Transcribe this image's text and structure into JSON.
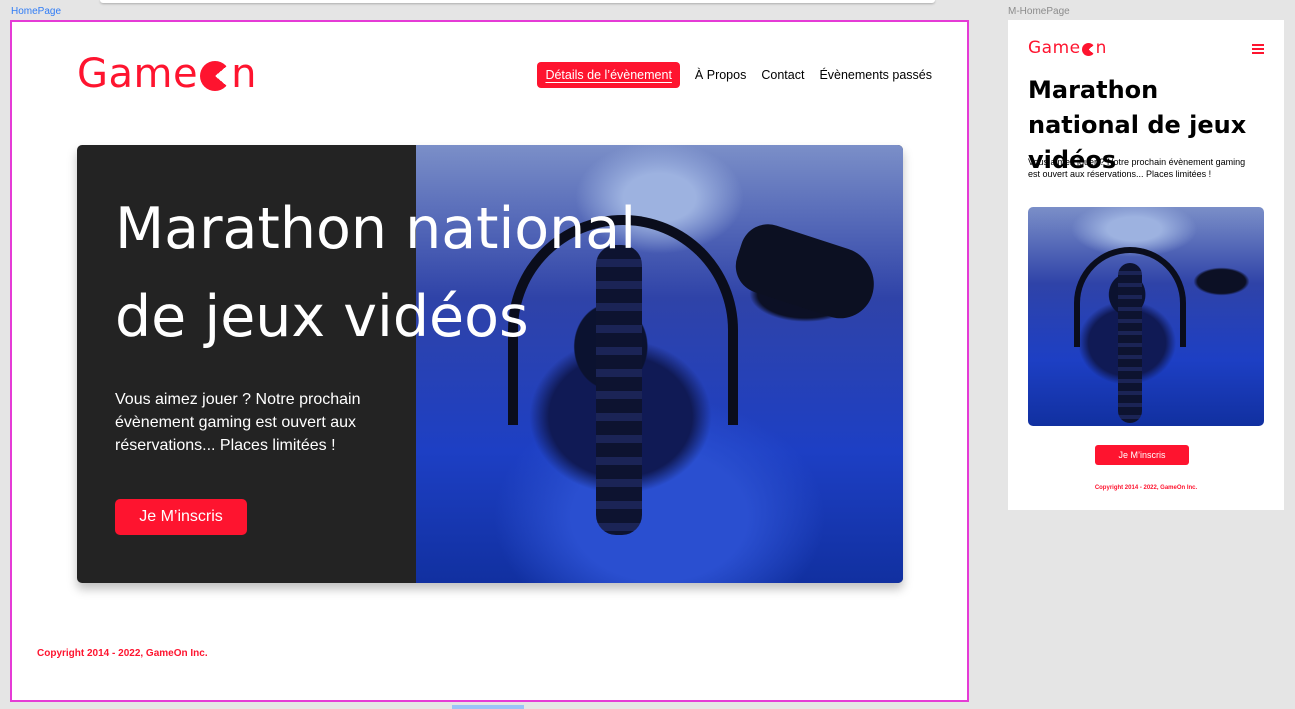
{
  "canvas": {
    "desktop_label": "HomePage",
    "mobile_label": "M-HomePage"
  },
  "brand": {
    "name_start": "Game",
    "name_end": "n",
    "color": "#fe142f"
  },
  "nav": {
    "items": [
      {
        "label": "Détails de l’évènement",
        "active": true
      },
      {
        "label": "À Propos",
        "active": false
      },
      {
        "label": "Contact",
        "active": false
      },
      {
        "label": "Évènements passés",
        "active": false
      }
    ]
  },
  "hero": {
    "title": "Marathon national de jeux vidéos",
    "text": "Vous aimez jouer ? Notre prochain évènement gaming est ouvert aux réservations... Places limitées !",
    "cta_label": "Je M’inscris"
  },
  "footer": {
    "copyright": "Copyright 2014 - 2022, GameOn Inc."
  },
  "icons": {
    "logo_glyph": "pacman-icon",
    "mobile_menu": "hamburger-menu-icon"
  }
}
